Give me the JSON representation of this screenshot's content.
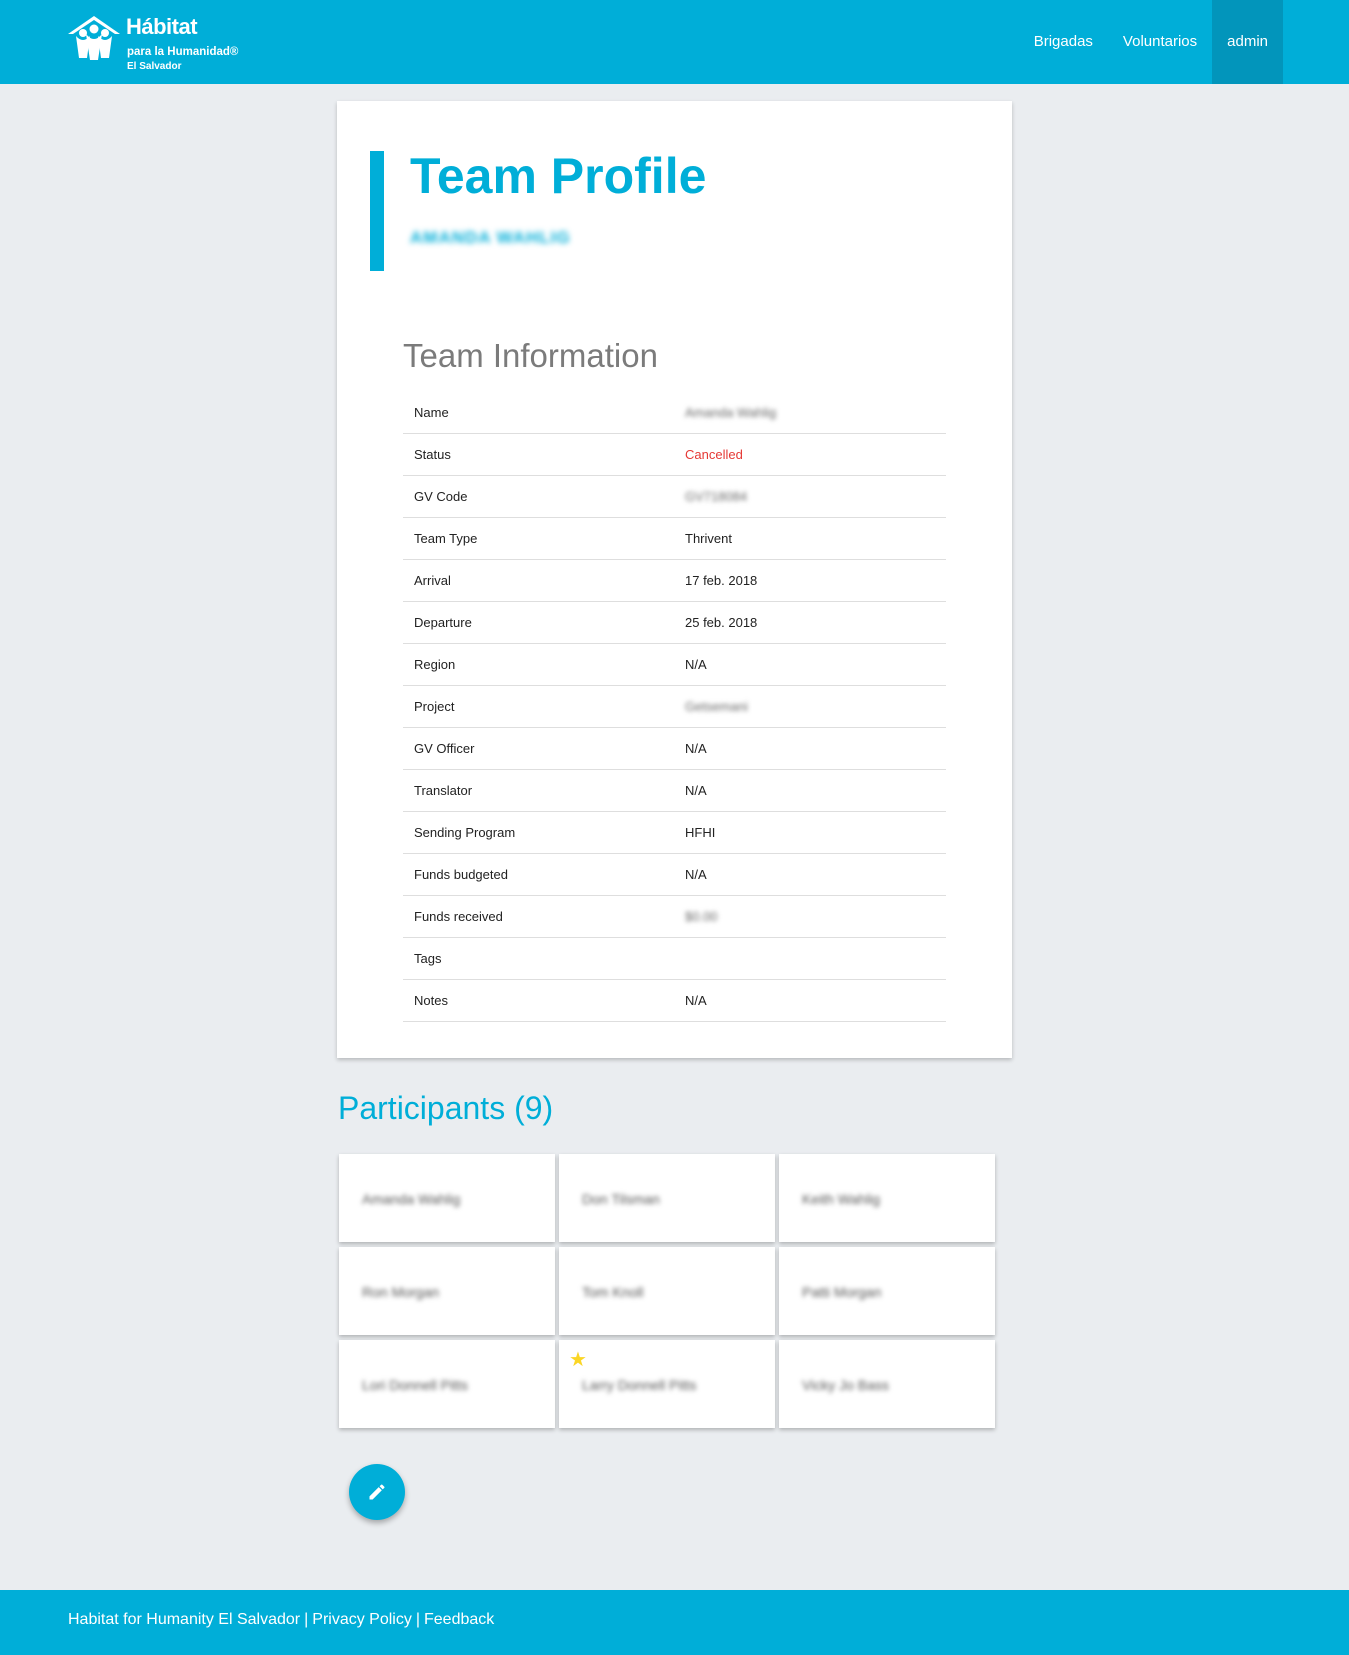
{
  "header": {
    "logo": {
      "title": "Hábitat",
      "subtitle": "para la Humanidad®",
      "country": "El Salvador"
    },
    "nav": [
      {
        "label": "Brigadas",
        "active": false
      },
      {
        "label": "Voluntarios",
        "active": false
      },
      {
        "label": "admin",
        "active": true
      }
    ]
  },
  "profile": {
    "title": "Team Profile",
    "subtitle": "AMANDA WAHLIG"
  },
  "team_info": {
    "title": "Team Information",
    "rows": [
      {
        "label": "Name",
        "value": "Amanda Wahlig"
      },
      {
        "label": "Status",
        "value": "Cancelled"
      },
      {
        "label": "GV Code",
        "value": "GV718084"
      },
      {
        "label": "Team Type",
        "value": "Thrivent"
      },
      {
        "label": "Arrival",
        "value": "17 feb. 2018"
      },
      {
        "label": "Departure",
        "value": "25 feb. 2018"
      },
      {
        "label": "Region",
        "value": "N/A"
      },
      {
        "label": "Project",
        "value": "Getsemani"
      },
      {
        "label": "GV Officer",
        "value": "N/A"
      },
      {
        "label": "Translator",
        "value": "N/A"
      },
      {
        "label": "Sending Program",
        "value": "HFHI"
      },
      {
        "label": "Funds budgeted",
        "value": "N/A"
      },
      {
        "label": "Funds received",
        "value": "$0.00"
      },
      {
        "label": "Tags",
        "value": ""
      },
      {
        "label": "Notes",
        "value": "N/A"
      }
    ]
  },
  "participants": {
    "title": "Participants (9)",
    "items": [
      {
        "name": "Amanda Wahlig",
        "leader": false
      },
      {
        "name": "Don Tilsman",
        "leader": false
      },
      {
        "name": "Keith Wahlig",
        "leader": false
      },
      {
        "name": "Ron Morgan",
        "leader": false
      },
      {
        "name": "Tom Knoll",
        "leader": false
      },
      {
        "name": "Patti Morgan",
        "leader": false
      },
      {
        "name": "Lori Donnell Pitts",
        "leader": false
      },
      {
        "name": "Larry Donnell Pitts",
        "leader": true
      },
      {
        "name": "Vicky Jo Bass",
        "leader": false
      }
    ],
    "star_icon": "star-icon"
  },
  "fab": {
    "icon": "pencil-icon"
  },
  "footer": {
    "org": "Habitat for Humanity El Salvador",
    "separator": "|",
    "privacy": "Privacy Policy",
    "feedback": "Feedback"
  },
  "colors": {
    "brand": "#00aed8",
    "nav_active": "#0295bb",
    "status_cancelled": "#e53935",
    "star": "#fbd625",
    "page_bg": "#eaedf0"
  }
}
